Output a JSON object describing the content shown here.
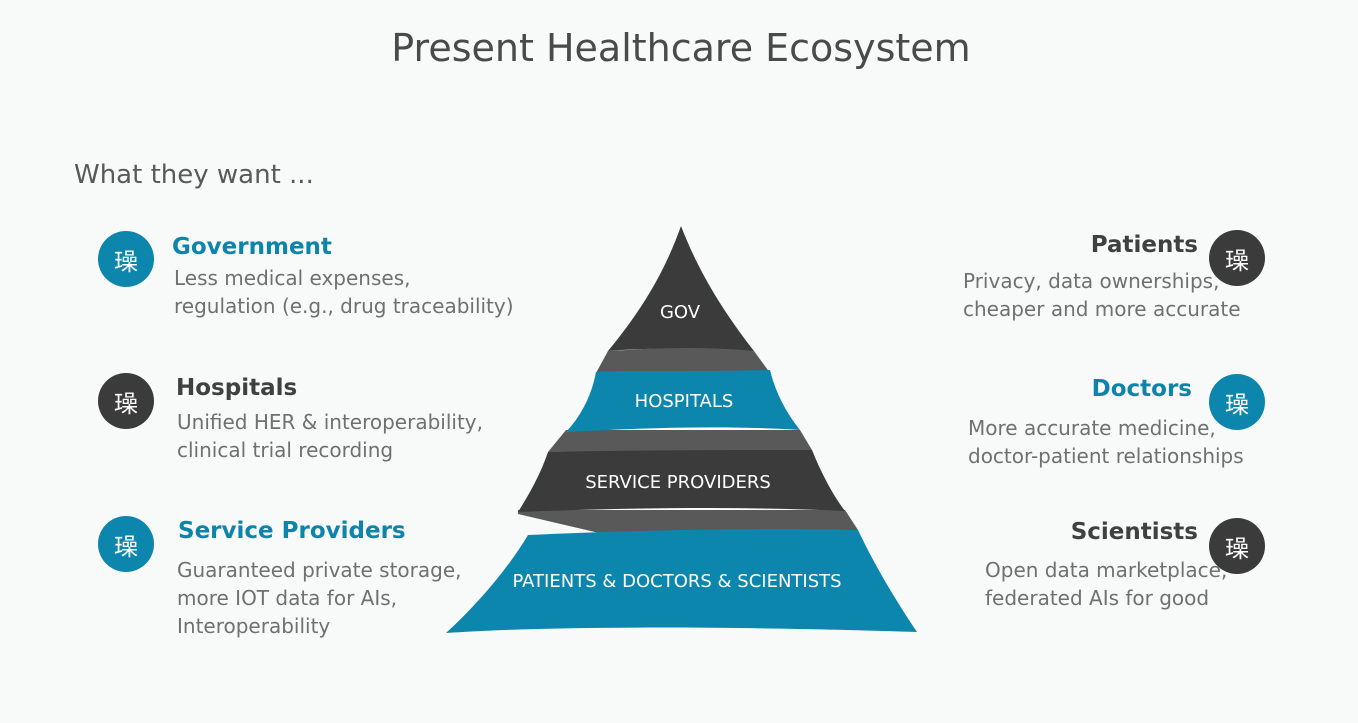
{
  "title": "Present Healthcare Ecosystem",
  "subtitle": "What they want ...",
  "icon_glyph": "璪",
  "left": [
    {
      "heading": "Government",
      "lines": [
        "Less medical expenses,",
        "regulation (e.g., drug traceability)"
      ]
    },
    {
      "heading": "Hospitals",
      "lines": [
        "Unified HER & interoperability,",
        "clinical trial recording"
      ]
    },
    {
      "heading": "Service Providers",
      "lines": [
        "Guaranteed private storage,",
        "more IOT data for AIs,",
        "Interoperability"
      ]
    }
  ],
  "right": [
    {
      "heading": "Patients",
      "lines": [
        "Privacy, data ownerships,",
        "cheaper and more accurate"
      ]
    },
    {
      "heading": "Doctors",
      "lines": [
        "More accurate medicine,",
        "doctor-patient relationships"
      ]
    },
    {
      "heading": "Scientists",
      "lines": [
        "Open data marketplace,",
        "federated AIs for good"
      ]
    }
  ],
  "pyramid": {
    "tiers": [
      "GOV",
      "HOSPITALS",
      "SERVICE PROVIDERS",
      "PATIENTS & DOCTORS & SCIENTISTS"
    ]
  },
  "colors": {
    "blue": "#0d86ad",
    "dark": "#3b3b3b",
    "ribbon": "#595959"
  }
}
